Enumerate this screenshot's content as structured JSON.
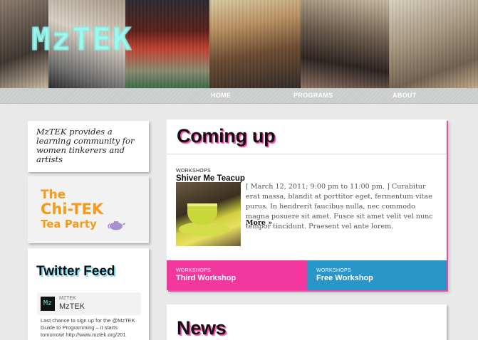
{
  "site": {
    "logo_text": "MzTEK"
  },
  "nav": {
    "items": [
      {
        "label": "HOME"
      },
      {
        "label": "PROGRAMS"
      },
      {
        "label": "ABOUT"
      }
    ]
  },
  "sidebar": {
    "tagline": "MzTEK provides a learning community for women tinkerers and artists",
    "promo": {
      "line1": "The",
      "line2": "Chi-TEK",
      "line3": "Tea Party"
    },
    "twitter": {
      "title": "Twitter Feed",
      "handle": "MZTEK",
      "name": "MzTEK",
      "avatar_text": "Mz",
      "tweet": "Last chance to sign up for the @MzTEK Guide to Programming – it starts tomorrow! http://www.mztek.org/201"
    }
  },
  "main": {
    "coming_up": {
      "heading": "Coming up",
      "featured": {
        "category": "WORKSHOPS",
        "title": "Shiver Me Teacup",
        "body": "[ March 12, 2011; 9:00 pm to 11:00 pm. ] Curabitur erat massa, blandit at porttitor eget, fermentum vitae purus. In hendrerit faucibus nulla, nec commodo magna posuere sit amet. Fusce sit amet velit vel nunc tempor tincidunt. Praesent vel ante lorem.",
        "more_label": "More »"
      },
      "tiles": [
        {
          "category": "WORKSHOPS",
          "title": "Third Workshop"
        },
        {
          "category": "WORKSHOPS",
          "title": "Free Workshop"
        }
      ]
    },
    "news": {
      "heading": "News"
    }
  },
  "colors": {
    "accent_pink": "#f2379f",
    "accent_blue": "#2896c8",
    "promo_orange": "#f59b19",
    "background": "#e9e9e9"
  }
}
